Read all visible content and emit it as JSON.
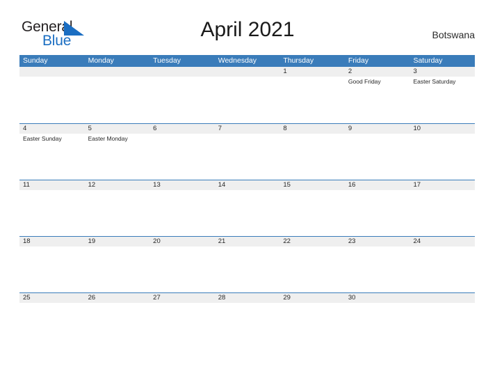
{
  "brand": {
    "name_part1": "General",
    "name_part2": "Blue",
    "triangle_color": "#1b6ec2"
  },
  "header": {
    "title": "April 2021",
    "country": "Botswana"
  },
  "theme": {
    "header_blue": "#3a7cba",
    "band_gray": "#efefef",
    "text_dark": "#262626"
  },
  "weekdays": [
    "Sunday",
    "Monday",
    "Tuesday",
    "Wednesday",
    "Thursday",
    "Friday",
    "Saturday"
  ],
  "weeks": [
    [
      {
        "date": "",
        "event": ""
      },
      {
        "date": "",
        "event": ""
      },
      {
        "date": "",
        "event": ""
      },
      {
        "date": "",
        "event": ""
      },
      {
        "date": "1",
        "event": ""
      },
      {
        "date": "2",
        "event": "Good Friday"
      },
      {
        "date": "3",
        "event": "Easter Saturday"
      }
    ],
    [
      {
        "date": "4",
        "event": "Easter Sunday"
      },
      {
        "date": "5",
        "event": "Easter Monday"
      },
      {
        "date": "6",
        "event": ""
      },
      {
        "date": "7",
        "event": ""
      },
      {
        "date": "8",
        "event": ""
      },
      {
        "date": "9",
        "event": ""
      },
      {
        "date": "10",
        "event": ""
      }
    ],
    [
      {
        "date": "11",
        "event": ""
      },
      {
        "date": "12",
        "event": ""
      },
      {
        "date": "13",
        "event": ""
      },
      {
        "date": "14",
        "event": ""
      },
      {
        "date": "15",
        "event": ""
      },
      {
        "date": "16",
        "event": ""
      },
      {
        "date": "17",
        "event": ""
      }
    ],
    [
      {
        "date": "18",
        "event": ""
      },
      {
        "date": "19",
        "event": ""
      },
      {
        "date": "20",
        "event": ""
      },
      {
        "date": "21",
        "event": ""
      },
      {
        "date": "22",
        "event": ""
      },
      {
        "date": "23",
        "event": ""
      },
      {
        "date": "24",
        "event": ""
      }
    ],
    [
      {
        "date": "25",
        "event": ""
      },
      {
        "date": "26",
        "event": ""
      },
      {
        "date": "27",
        "event": ""
      },
      {
        "date": "28",
        "event": ""
      },
      {
        "date": "29",
        "event": ""
      },
      {
        "date": "30",
        "event": ""
      },
      {
        "date": "",
        "event": ""
      }
    ]
  ]
}
